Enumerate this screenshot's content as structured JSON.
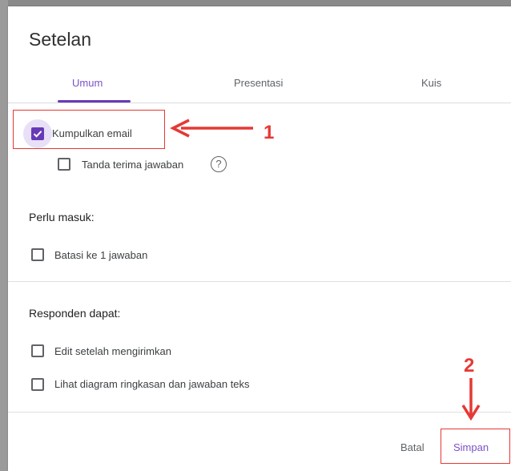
{
  "dialog": {
    "title": "Setelan"
  },
  "tabs": [
    {
      "label": "Umum",
      "active": true
    },
    {
      "label": "Presentasi",
      "active": false
    },
    {
      "label": "Kuis",
      "active": false
    }
  ],
  "options": {
    "collect_email": {
      "label": "Kumpulkan email",
      "checked": true
    },
    "response_receipts": {
      "label": "Tanda terima jawaban",
      "checked": false
    }
  },
  "sections": {
    "requires_signin": {
      "heading": "Perlu masuk:",
      "items": [
        {
          "label": "Batasi ke 1 jawaban",
          "checked": false
        }
      ]
    },
    "respondents_can": {
      "heading": "Responden dapat:",
      "items": [
        {
          "label": "Edit setelah mengirimkan",
          "checked": false
        },
        {
          "label": "Lihat diagram ringkasan dan jawaban teks",
          "checked": false
        }
      ]
    }
  },
  "footer": {
    "cancel_label": "Batal",
    "save_label": "Simpan"
  },
  "annotations": {
    "step1": "1",
    "step2": "2",
    "color": "#e53935"
  },
  "colors": {
    "accent": "#673ab7",
    "text": "#3c4043"
  },
  "icons": {
    "help": "help-circle-icon",
    "check": "checkmark-icon"
  }
}
